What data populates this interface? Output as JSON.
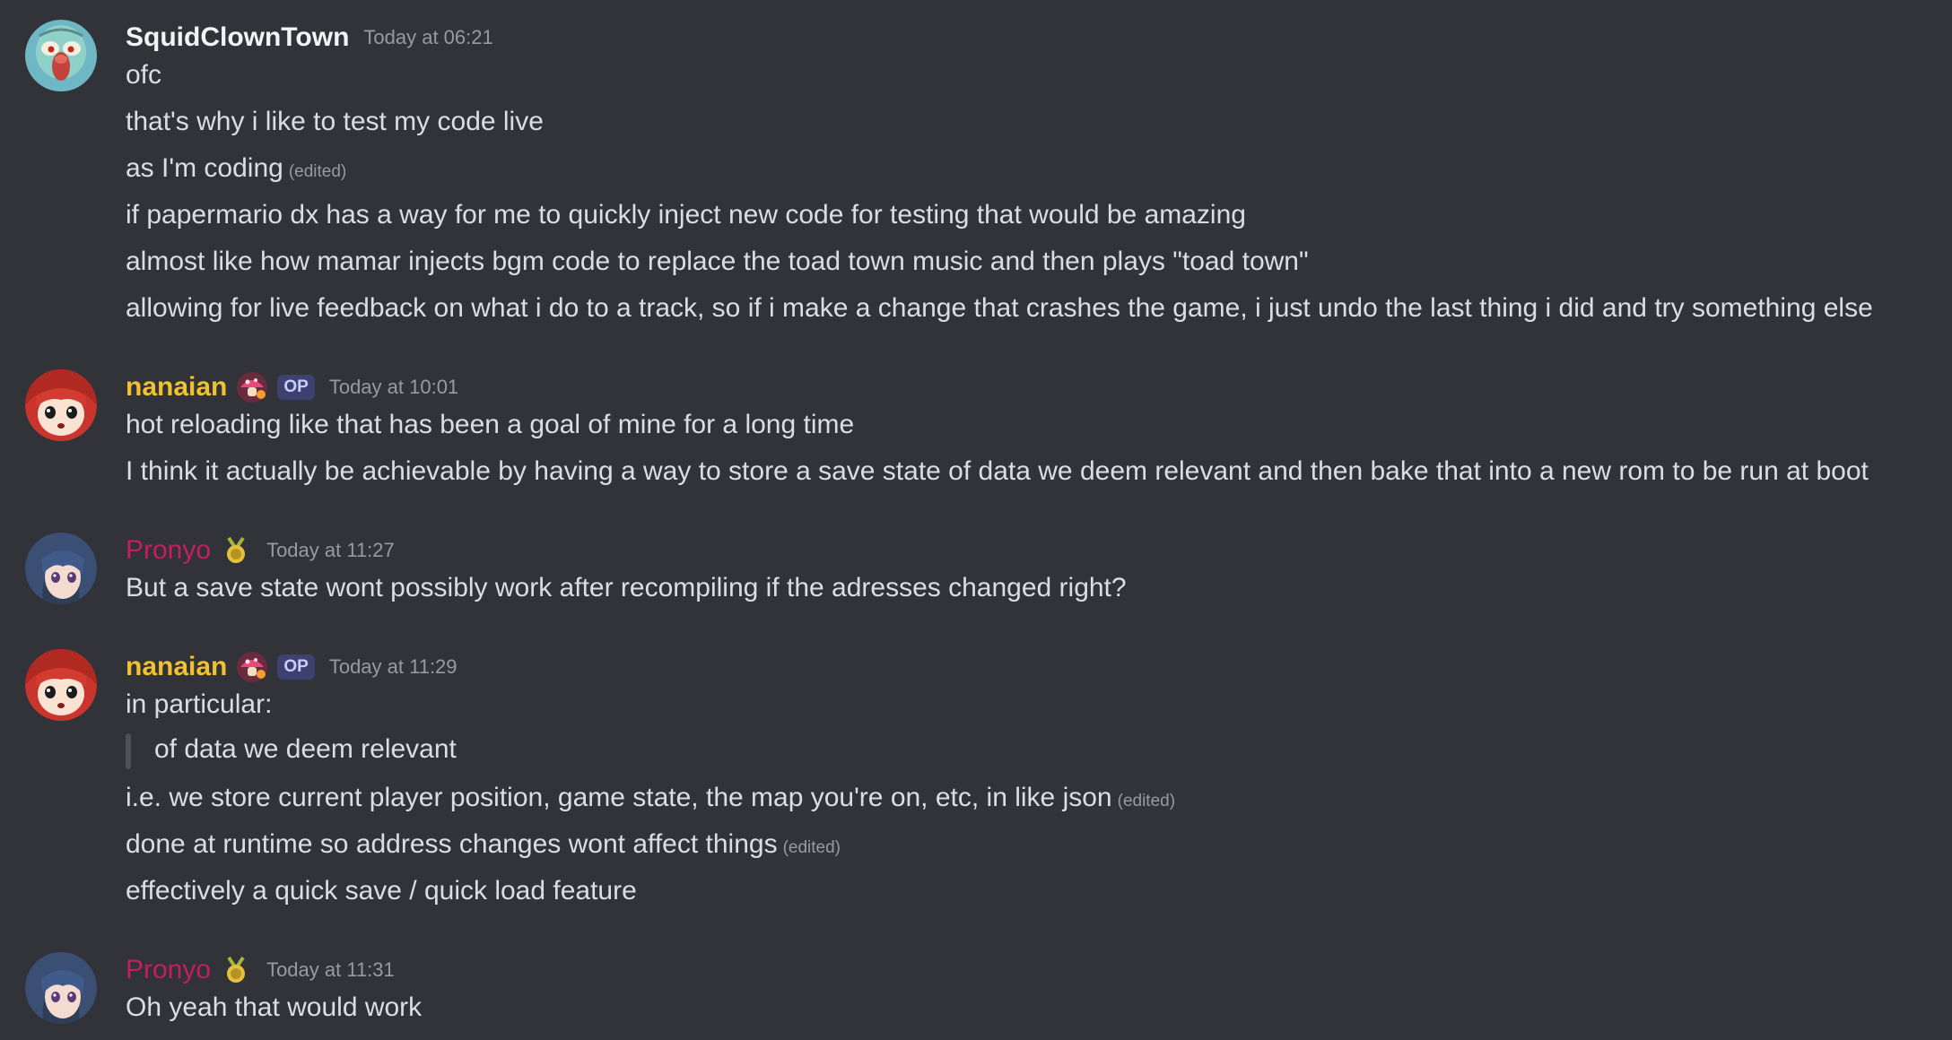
{
  "colors": {
    "background": "#313338",
    "text": "#dbdee1",
    "muted": "#949ba4",
    "squid_name": "#f2f3f5",
    "nanaian_name": "#f0c232",
    "pronyo_name": "#c41f5c"
  },
  "messages": [
    {
      "author": "SquidClownTown",
      "timestamp": "Today at 06:21",
      "avatar_icon": "squidward-avatar",
      "lines": [
        {
          "text": "ofc",
          "edited": ""
        },
        {
          "text": "that's why i like to test my code live",
          "edited": ""
        },
        {
          "text": "as I'm coding",
          "edited": "(edited)"
        },
        {
          "text": "if papermario dx has a way for me to quickly inject new code for testing that would be amazing",
          "edited": ""
        },
        {
          "text": "almost like how mamar injects bgm code to replace the toad town music and then plays \"toad town\"",
          "edited": ""
        },
        {
          "text": "allowing for live feedback on what i do to a track, so if i make a change that crashes the game, i just undo the last thing i did and try something else",
          "edited": ""
        }
      ]
    },
    {
      "author": "nanaian",
      "timestamp": "Today at 10:01",
      "avatar_icon": "anime-girl-red-hair-avatar",
      "role_icon": "mushroom-icon",
      "tag": "OP",
      "lines": [
        {
          "text": "hot reloading like that has been a goal of mine for a long time",
          "edited": ""
        },
        {
          "text": "I think it actually be achievable by having a way to store a save state of data we deem relevant and then bake that into a new rom to be run at boot",
          "edited": ""
        }
      ]
    },
    {
      "author": "Pronyo",
      "timestamp": "Today at 11:27",
      "avatar_icon": "anime-girl-blue-hair-avatar",
      "role_icon": "medal-icon",
      "lines": [
        {
          "text": "But a save state wont possibly work after recompiling if the adresses changed right?",
          "edited": ""
        }
      ]
    },
    {
      "author": "nanaian",
      "timestamp": "Today at 11:29",
      "avatar_icon": "anime-girl-red-hair-avatar",
      "role_icon": "mushroom-icon",
      "tag": "OP",
      "intro": "in particular:",
      "quote": "of data we deem relevant",
      "lines": [
        {
          "text": "i.e. we store current player position, game state, the map you're on, etc, in like json",
          "edited": "(edited)"
        },
        {
          "text": "done at runtime so address changes wont affect things",
          "edited": "(edited)"
        },
        {
          "text": "effectively a quick save / quick load feature",
          "edited": ""
        }
      ]
    },
    {
      "author": "Pronyo",
      "timestamp": "Today at 11:31",
      "avatar_icon": "anime-girl-blue-hair-avatar",
      "role_icon": "medal-icon",
      "lines": [
        {
          "text": "Oh yeah that would work",
          "edited": ""
        }
      ]
    }
  ]
}
